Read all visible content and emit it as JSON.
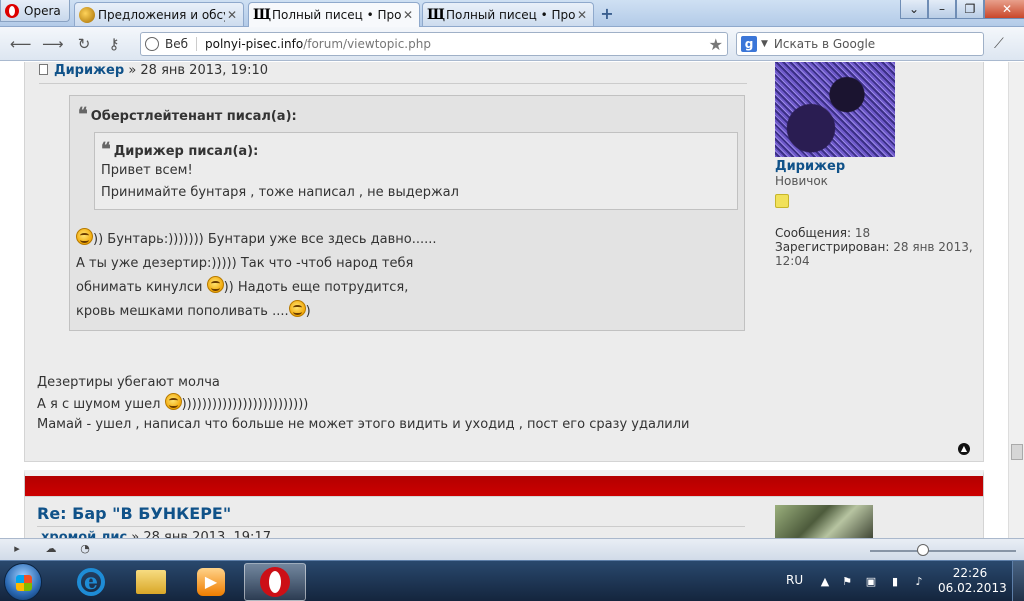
{
  "browser": {
    "menu_label": "Opera",
    "tabs": [
      {
        "title": "Предложения и обсу...",
        "icon": "forum-favicon"
      },
      {
        "title": "Полный писец • Прос...",
        "icon": "pp-favicon",
        "active": true
      },
      {
        "title": "Полный писец • Прос...",
        "icon": "pp-favicon"
      }
    ],
    "favicon_letters": "Щ",
    "address": {
      "scheme_label": "Веб",
      "host": "polnyi-pisec.info",
      "path": "/forum/viewtopic.php"
    },
    "search": {
      "engine": "g",
      "placeholder": "Искать в Google"
    }
  },
  "post1": {
    "author": "Дирижер",
    "date": "» 28 янв 2013, 19:10",
    "outer_quote": {
      "header": "Оберстлейтенант писал(а):",
      "inner_quote": {
        "header": "Дирижер писал(а):",
        "lines": [
          "Привет всем!",
          "Принимайте бунтаря , тоже написал , не выдержал"
        ]
      },
      "lines": [
        {
          "pre": "",
          "smile": true,
          "post": ")) Бунтарь:))))))) Бунтари уже все здесь давно......"
        },
        {
          "pre": "А ты уже дезертир:))))) Так что -чтоб народ тебя",
          "smile": false,
          "post": ""
        },
        {
          "pre": "обнимать кинулси ",
          "smile": true,
          "post": ")) Надоть еще потрудится,"
        },
        {
          "pre": "кровь мешками пополивать ....",
          "smile": true,
          "post": ")"
        }
      ]
    },
    "text_lines": [
      {
        "pre": "Дезертиры убегают молча",
        "smile": false,
        "post": ""
      },
      {
        "pre": "А я с шумом ушел ",
        "smile": true,
        "post": ")))))))))))))))))))))))))"
      },
      {
        "pre": "Мамай - ушел , написал что больше не может этого видить и уходид , пост его сразу удалили",
        "smile": false,
        "post": ""
      }
    ],
    "profile": {
      "username": "Дирижер",
      "rank": "Новичок",
      "posts_label": "Сообщения:",
      "posts_value": "18",
      "registered_label": "Зарегистрирован:",
      "registered_value": "28 янв 2013, 12:04"
    }
  },
  "post2": {
    "title": "Re: Бар \"В БУНКЕРЕ\"",
    "author": "хромой лис",
    "date": "» 28 янв 2013, 19:17"
  },
  "taskbar": {
    "language": "RU",
    "time": "22:26",
    "date": "06.02.2013"
  }
}
